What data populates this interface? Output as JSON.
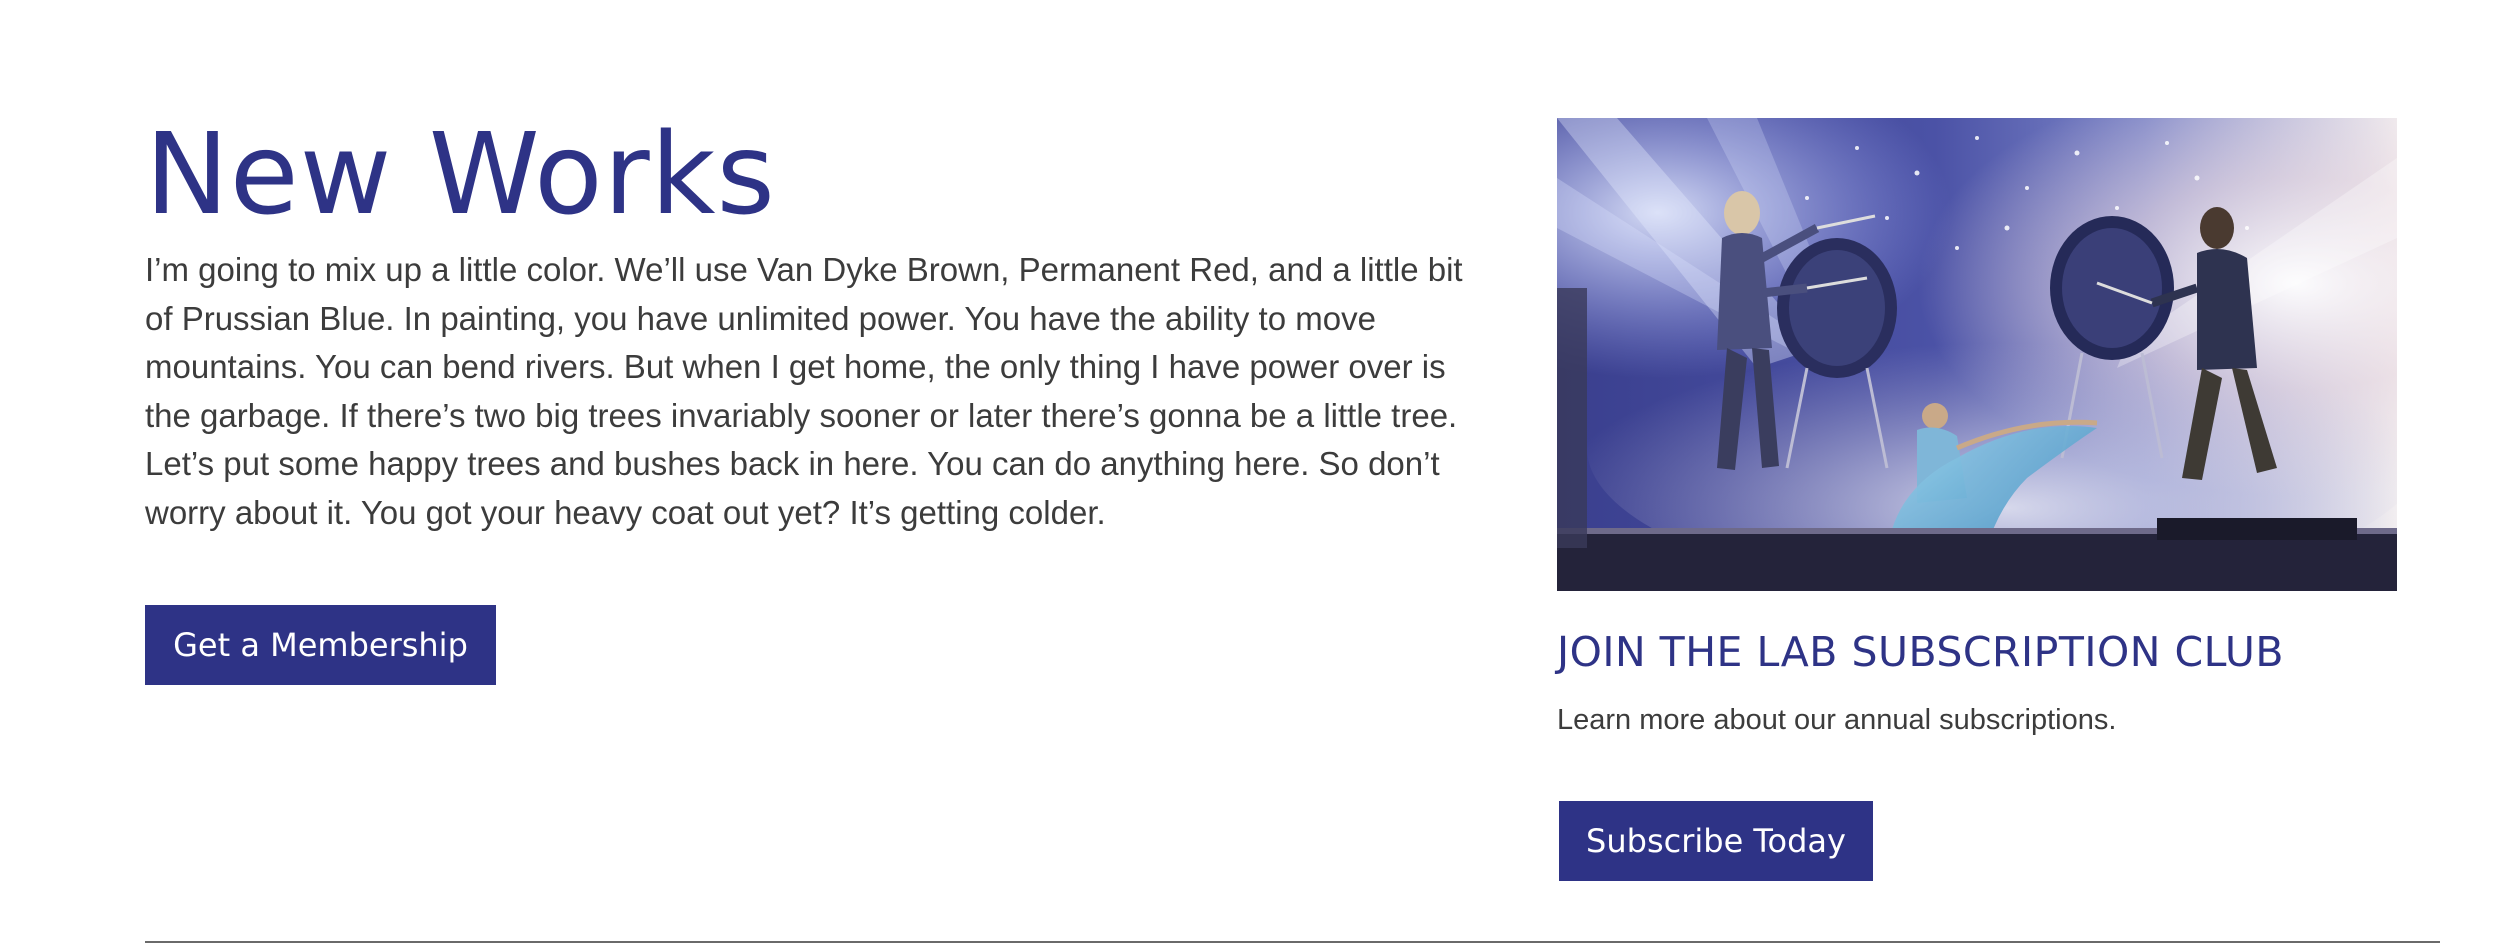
{
  "main": {
    "title": "New Works",
    "body": "I’m going to mix up a little color. We’ll use Van Dyke Brown, Permanent Red, and a little bit of Prussian Blue. In painting, you have unlimited power. You have the ability to move mountains. You can bend rivers. But when I get home, the only thing I have power over is the garbage. If there’s two big trees invariably sooner or later there’s gonna be a little tree. Let’s put some happy trees and bushes back in here. You can do anything here. So don’t worry about it. You got your heavy coat out yet? It’s getting colder.",
    "membership_button": "Get a Membership"
  },
  "subscription": {
    "image_icon": "drummers-performance-photo",
    "title": "JOIN THE LAB SUBSCRIPTION CLUB",
    "text": "Learn more about our annual subscriptions.",
    "subscribe_button": "Subscribe Today"
  },
  "colors": {
    "brand": "#2e3386",
    "text": "#3c3c3c",
    "divider": "#6a6a6a",
    "background": "#ffffff"
  }
}
